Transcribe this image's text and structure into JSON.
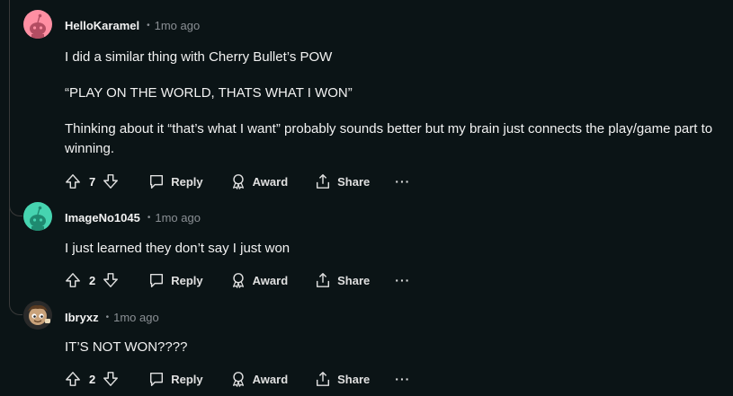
{
  "comments": [
    {
      "author": "HelloKaramel",
      "separator": "•",
      "time": "1mo ago",
      "paragraphs": [
        "I did a similar thing with Cherry Bullet’s POW",
        "“PLAY ON THE WORLD, THATS WHAT I WON”",
        "Thinking about it “that’s what I want” probably sounds better but my brain just connects the play/game part to winning."
      ],
      "votes": "7",
      "avatar_color": "#ff8fa3"
    },
    {
      "author": "ImageNo1045",
      "separator": "•",
      "time": "1mo ago",
      "paragraphs": [
        "I just learned they don’t say I just won"
      ],
      "votes": "2",
      "avatar_color": "#46d4b0"
    },
    {
      "author": "Ibryxz",
      "separator": "•",
      "time": "1mo ago",
      "paragraphs": [
        "IT’S NOT WON????"
      ],
      "votes": "2",
      "avatar_color": "#c9a27a"
    }
  ],
  "actions": {
    "reply": "Reply",
    "award": "Award",
    "share": "Share",
    "more": "···"
  },
  "colors": {
    "background": "#0b1416",
    "text": "#f2f2f2",
    "muted": "#8a8f94",
    "thread_line": "#3a3a3a"
  },
  "icons": [
    "upvote-icon",
    "downvote-icon",
    "reply-icon",
    "award-icon",
    "share-icon",
    "more-icon",
    "snoo-avatar-icon"
  ]
}
